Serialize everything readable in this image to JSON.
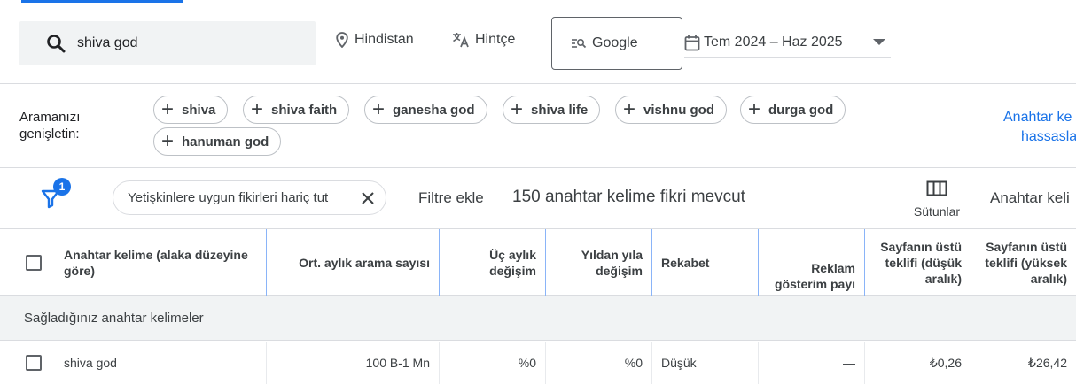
{
  "search": {
    "query": "shiva god",
    "location": "Hindistan",
    "language": "Hintçe",
    "network": "Google",
    "date_range": "Tem 2024 – Haz 2025"
  },
  "expand": {
    "label_line1": "Aramanızı",
    "label_line2": "genişletin:",
    "chips": [
      "shiva",
      "shiva faith",
      "ganesha god",
      "shiva life",
      "vishnu god",
      "durga god",
      "hanuman god"
    ],
    "refine_line1": "Anahtar ke",
    "refine_line2": "hassasla"
  },
  "filter": {
    "badge_count": "1",
    "adult_chip": "Yetişkinlere uygun fikirleri hariç tut",
    "add_filter": "Filtre ekle",
    "idea_count": "150 anahtar kelime fikri mevcut",
    "columns_label": "Sütunlar",
    "keyword_view": "Anahtar keli"
  },
  "table": {
    "headers": {
      "keyword": "Anahtar kelime (alaka düzeyine göre)",
      "avg_searches": "Ort. aylık arama sayısı",
      "three_month": "Üç aylık değişim",
      "yoy": "Yıldan yıla değişim",
      "competition": "Rekabet",
      "impression_share": "Reklam gösterim payı",
      "bid_low": "Sayfanın üstü teklifi (düşük aralık)",
      "bid_high": "Sayfanın üstü teklifi (yüksek aralık)"
    },
    "group_label": "Sağladığınız anahtar kelimeler",
    "rows": [
      {
        "keyword": "shiva god",
        "avg_searches": "100 B-1 Mn",
        "three_month": "%0",
        "yoy": "%0",
        "competition": "Düşük",
        "impression_share": "—",
        "bid_low": "₺0,26",
        "bid_high": "₺26,42"
      }
    ]
  },
  "colors": {
    "accent": "#1a73e8",
    "divider": "#dadce0",
    "header_divider": "#8ab4f8",
    "group_bg": "#f1f3f4"
  },
  "icons": {
    "search": "search-icon",
    "location": "location-pin-icon",
    "language": "translate-icon",
    "network": "search-network-icon",
    "date": "calendar-icon",
    "filter": "filter-funnel-icon",
    "close": "close-icon",
    "columns": "columns-icon",
    "add": "plus-icon"
  }
}
